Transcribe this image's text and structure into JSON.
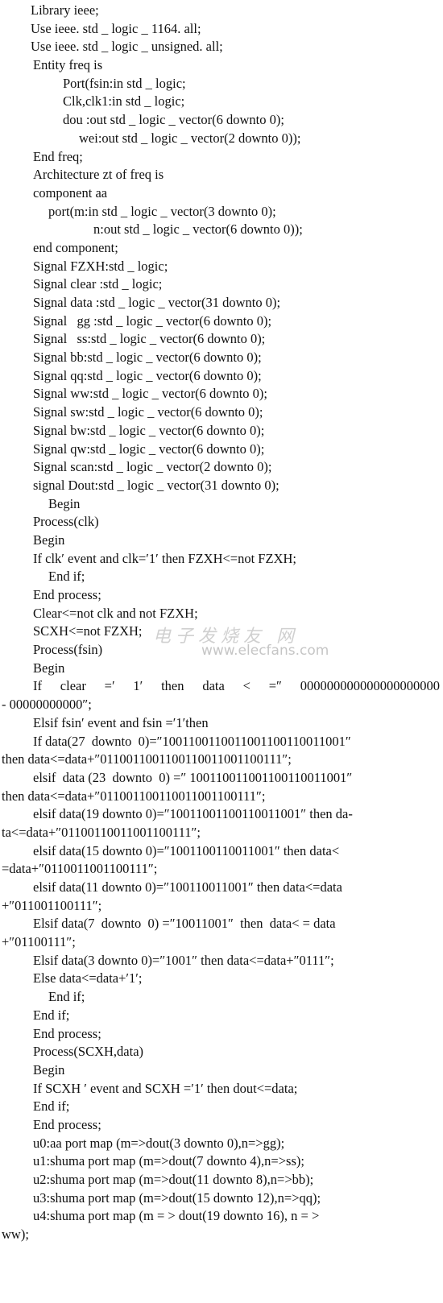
{
  "code_lines": [
    {
      "indent": "i1",
      "text": "Library ieee;"
    },
    {
      "indent": "i1",
      "text": "Use ieee. std _ logic _ 1164. all;"
    },
    {
      "indent": "i1",
      "text": "Use ieee. std _ logic _ unsigned. all;"
    },
    {
      "indent": "i2",
      "text": "Entity freq is"
    },
    {
      "indent": "i4",
      "text": "Port(fsin:in std _ logic;"
    },
    {
      "indent": "i4",
      "text": "Clk,clk1:in std _ logic;"
    },
    {
      "indent": "i4",
      "text": "dou :out std _ logic _ vector(6 downto 0);"
    },
    {
      "indent": "i5",
      "text": "wei:out std _ logic _ vector(2 downto 0));"
    },
    {
      "indent": "i2",
      "text": "End freq;"
    },
    {
      "indent": "i2",
      "text": "Architecture zt of freq is"
    },
    {
      "indent": "i2",
      "text": "component aa"
    },
    {
      "indent": "i3",
      "text": "port(m:in std _ logic _ vector(3 downto 0);"
    },
    {
      "indent": "i6",
      "text": "n:out std _ logic _ vector(6 downto 0));"
    },
    {
      "indent": "i2",
      "text": "end component;"
    },
    {
      "indent": "i2",
      "text": "Signal FZXH:std _ logic;"
    },
    {
      "indent": "i2",
      "text": "Signal clear :std _ logic;"
    },
    {
      "indent": "i2",
      "text": "Signal data :std _ logic _ vector(31 downto 0);"
    },
    {
      "indent": "i2",
      "text": "Signal   gg :std _ logic _ vector(6 downto 0);"
    },
    {
      "indent": "i2",
      "text": "Signal   ss:std _ logic _ vector(6 downto 0);"
    },
    {
      "indent": "i2",
      "text": "Signal bb:std _ logic _ vector(6 downto 0);"
    },
    {
      "indent": "i2",
      "text": "Signal qq:std _ logic _ vector(6 downto 0);"
    },
    {
      "indent": "i2",
      "text": "Signal ww:std _ logic _ vector(6 downto 0);"
    },
    {
      "indent": "i2",
      "text": "Signal sw:std _ logic _ vector(6 downto 0);"
    },
    {
      "indent": "i2",
      "text": "Signal bw:std _ logic _ vector(6 downto 0);"
    },
    {
      "indent": "i2",
      "text": "Signal qw:std _ logic _ vector(6 downto 0);"
    },
    {
      "indent": "i2",
      "text": "Signal scan:std _ logic _ vector(2 downto 0);"
    },
    {
      "indent": "i2",
      "text": "signal Dout:std _ logic _ vector(31 downto 0);"
    },
    {
      "indent": "i3",
      "text": "Begin"
    },
    {
      "indent": "i2",
      "text": "Process(clk)"
    },
    {
      "indent": "i2",
      "text": "Begin"
    },
    {
      "indent": "i2",
      "text": "If clk′ event and clk=′1′ then FZXH<=not FZXH;"
    },
    {
      "indent": "i3",
      "text": "End if;"
    },
    {
      "indent": "i2",
      "text": "End process;"
    },
    {
      "indent": "i2",
      "text": "Clear<=not clk and not FZXH;"
    },
    {
      "indent": "i2",
      "text": "SCXH<=not FZXH;"
    },
    {
      "indent": "i2",
      "text": "Process(fsin)"
    },
    {
      "indent": "i2",
      "text": "Begin"
    },
    {
      "indent": "i2",
      "text": "If  clear  =′ 1′  then  data  <  =″ 000000000000000000000",
      "justify": true
    },
    {
      "indent": "i0",
      "text": "- 00000000000″;"
    },
    {
      "indent": "i2",
      "text": "Elsif fsin′ event and fsin =′1′then"
    },
    {
      "indent": "i2",
      "text": "If data(27  downto  0)=″1001100110011001100110011001″"
    },
    {
      "indent": "i0",
      "text": "then data<=data+″0110011001100110011001100111″;"
    },
    {
      "indent": "i2",
      "text": "elsif  data (23  downto  0) =″ 100110011001100110011001″"
    },
    {
      "indent": "i0",
      "text": "then data<=data+″011001100110011001100111″;"
    },
    {
      "indent": "i2",
      "text": "elsif data(19 downto 0)=″10011001100110011001″ then da-"
    },
    {
      "indent": "i0",
      "text": "ta<=data+″01100110011001100111″;"
    },
    {
      "indent": "i2",
      "text": "elsif data(15 downto 0)=″1001100110011001″ then data<"
    },
    {
      "indent": "i0",
      "text": "=data+″0110011001100111″;"
    },
    {
      "indent": "i2",
      "text": "elsif data(11 downto 0)=″100110011001″ then data<=data"
    },
    {
      "indent": "i0",
      "text": "+″011001100111″;"
    },
    {
      "indent": "i2",
      "text": "Elsif data(7  downto  0) =″10011001″  then  data< = data"
    },
    {
      "indent": "i0",
      "text": "+″01100111″;"
    },
    {
      "indent": "i2",
      "text": "Elsif data(3 downto 0)=″1001″ then data<=data+″0111″;"
    },
    {
      "indent": "i2",
      "text": "Else data<=data+′1′;"
    },
    {
      "indent": "i3",
      "text": "End if;"
    },
    {
      "indent": "i2",
      "text": "End if;"
    },
    {
      "indent": "i2",
      "text": "End process;"
    },
    {
      "indent": "i2",
      "text": "Process(SCXH,data)"
    },
    {
      "indent": "i2",
      "text": "Begin"
    },
    {
      "indent": "i2",
      "text": "If SCXH ′ event and SCXH =′1′ then dout<=data;"
    },
    {
      "indent": "i2",
      "text": "End if;"
    },
    {
      "indent": "i2",
      "text": "End process;"
    },
    {
      "indent": "i2",
      "text": "u0:aa port map (m=>dout(3 downto 0),n=>gg);"
    },
    {
      "indent": "i2",
      "text": "u1:shuma port map (m=>dout(7 downto 4),n=>ss);"
    },
    {
      "indent": "i2",
      "text": "u2:shuma port map (m=>dout(11 downto 8),n=>bb);"
    },
    {
      "indent": "i2",
      "text": "u3:shuma port map (m=>dout(15 downto 12),n=>qq);"
    },
    {
      "indent": "i2",
      "text": "u4:shuma port map (m = > dout(19 downto 16), n = >"
    },
    {
      "indent": "i0",
      "text": "ww);"
    }
  ],
  "watermark": {
    "site_name": "电子发烧友 网",
    "url": "www.elecfans.com"
  }
}
